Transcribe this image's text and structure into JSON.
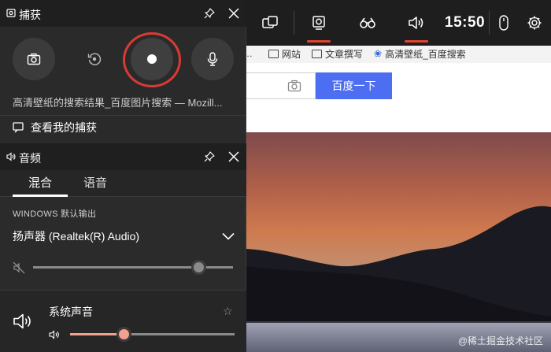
{
  "capture": {
    "title": "捕获",
    "target": "高清壁纸的搜索结果_百度图片搜索 — Mozill...",
    "view_captures": "查看我的捕获"
  },
  "audio": {
    "title": "音频",
    "tabs": [
      "混合",
      "语音"
    ],
    "default_output_label": "WINDOWS 默认输出",
    "device": "扬声器 (Realtek(R) Audio)",
    "master_volume": 0.83,
    "system_sound_label": "系统声音",
    "system_volume": 0.33
  },
  "topbar": {
    "time": "15:50"
  },
  "browser": {
    "bookmarks": [
      "网站",
      "文章撰写",
      "高清壁纸_百度搜索"
    ],
    "search_button": "百度一下"
  },
  "watermark": "@稀土掘金技术社区",
  "colors": {
    "record_ring": "#d93a35",
    "accent_orange": "#e0432f",
    "slider_fill": "#f4a08e",
    "baidu_blue": "#4e6ef2"
  }
}
